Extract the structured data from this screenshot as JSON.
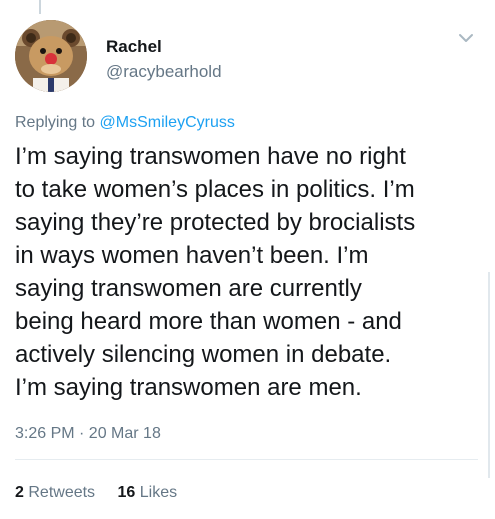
{
  "author": {
    "name": "Rachel",
    "handle": "@racybearhold",
    "avatar_icon": "bear-avatar-icon"
  },
  "menu_icon": "chevron-down-icon",
  "reply": {
    "prefix": "Replying to",
    "mention": "@MsSmileyCyruss"
  },
  "tweet": {
    "lines": [
      "I’m saying transwomen have no right",
      "to take women’s places in politics. I’m",
      "saying they’re protected by brocialists",
      "in ways women haven’t been. I’m",
      "saying transwomen are currently",
      "being heard more than women - and",
      "actively silencing women in debate.",
      "I’m saying transwomen are men."
    ]
  },
  "timestamp": "3:26 PM · 20 Mar 18",
  "stats": {
    "retweets_count": "2",
    "retweets_label": "Retweets",
    "likes_count": "16",
    "likes_label": "Likes"
  },
  "colors": {
    "link": "#1da1f2",
    "secondary_text": "#657786",
    "primary_text": "#14171a",
    "divider": "#e6ecf0"
  }
}
